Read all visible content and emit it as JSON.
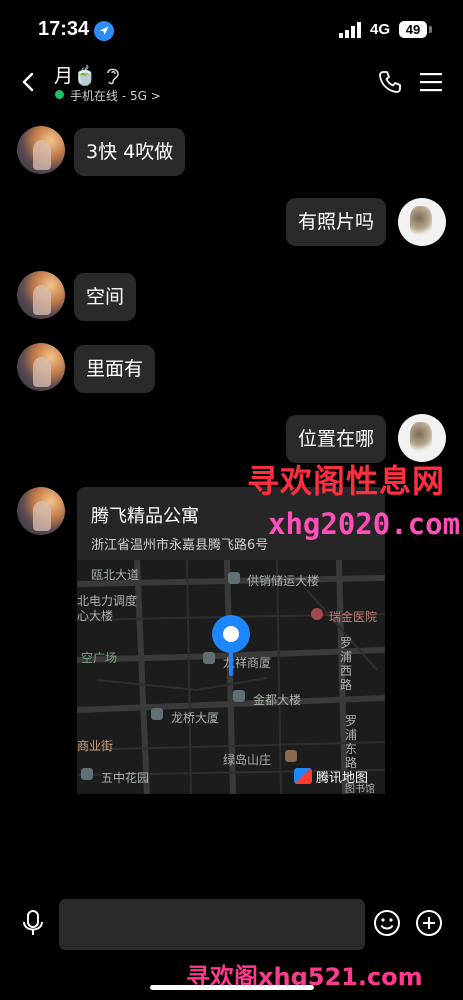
{
  "status": {
    "time": "17:34",
    "network": "4G",
    "battery": "49"
  },
  "header": {
    "name": "月🍵",
    "online": "手机在线 - 5G",
    "online_chevron": ">"
  },
  "messages": [
    {
      "side": "left",
      "text": "3快 4吹做"
    },
    {
      "side": "right",
      "text": "有照片吗"
    },
    {
      "side": "left",
      "text": "空间"
    },
    {
      "side": "left",
      "text": "里面有"
    },
    {
      "side": "right",
      "text": "位置在哪"
    }
  ],
  "location_card": {
    "title": "腾飞精品公寓",
    "address": "浙江省温州市永嘉县腾飞路6号",
    "provider": "腾讯地图",
    "map_labels": [
      "瓯北大道",
      "供销储运大楼",
      "北电力调度",
      "心大楼",
      "瑞金医院",
      "罗",
      "浦",
      "西",
      "路",
      "空广场",
      "龙祥商厦",
      "金都大楼",
      "龙桥大厦",
      "罗",
      "浦",
      "东",
      "路",
      "商业街",
      "绿岛山庄",
      "五中花园",
      "图书馆"
    ]
  },
  "watermarks": {
    "line1": "寻欢阁性息网",
    "line2": "xhg2020.com",
    "line3": "寻欢阁xhg521.com"
  },
  "colors": {
    "accent": "#1e86ff",
    "online": "#19c46b",
    "watermark_red": "#ff2f3f",
    "watermark_pink": "#ff4fb8"
  }
}
